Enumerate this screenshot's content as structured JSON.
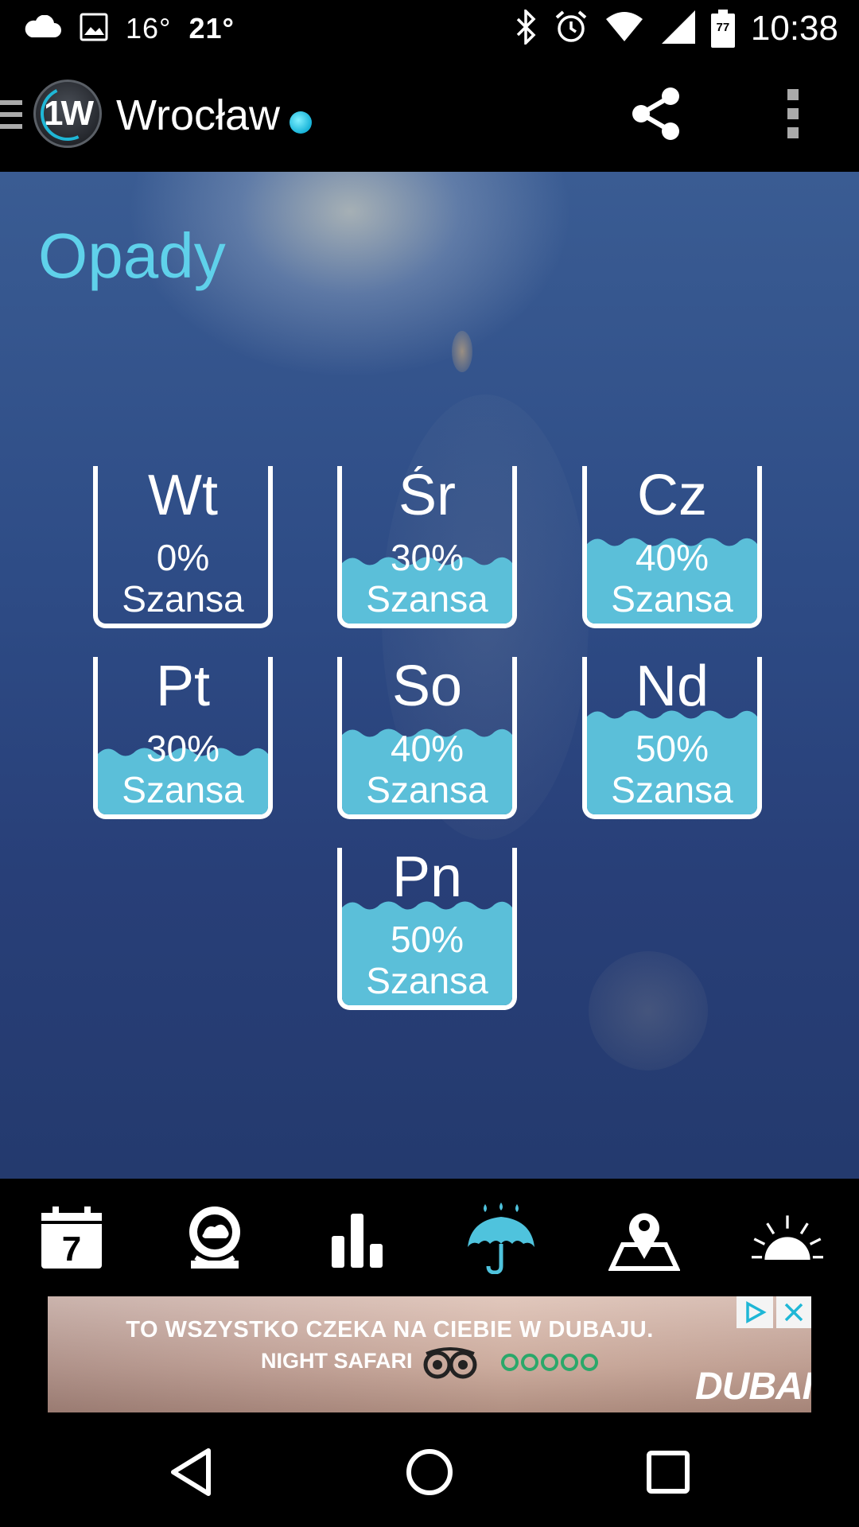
{
  "status_bar": {
    "temp_low": "16°",
    "temp_high": "21°",
    "clock": "10:38",
    "battery_level": "77",
    "icons": [
      "cloud-icon",
      "image-icon",
      "bluetooth-icon",
      "alarm-icon",
      "wifi-icon",
      "signal-icon",
      "battery-icon"
    ]
  },
  "app_bar": {
    "logo_text": "1W",
    "city": "Wrocław",
    "accent_color": "#1fb7d6",
    "actions": [
      "share-icon",
      "more-vert-icon"
    ]
  },
  "section": {
    "title": "Opady",
    "title_color": "#5fd1ea"
  },
  "forecast": [
    {
      "day": "Wt",
      "percent": "0%",
      "label": "Szansa",
      "value": 0
    },
    {
      "day": "Śr",
      "percent": "30%",
      "label": "Szansa",
      "value": 30
    },
    {
      "day": "Cz",
      "percent": "40%",
      "label": "Szansa",
      "value": 40
    },
    {
      "day": "Pt",
      "percent": "30%",
      "label": "Szansa",
      "value": 30
    },
    {
      "day": "So",
      "percent": "40%",
      "label": "Szansa",
      "value": 40
    },
    {
      "day": "Nd",
      "percent": "50%",
      "label": "Szansa",
      "value": 50
    },
    {
      "day": "Pn",
      "percent": "50%",
      "label": "Szansa",
      "value": 50
    }
  ],
  "water_color": "#5bbfd9",
  "bottom_nav": {
    "calendar_day": "7",
    "items": [
      "calendar-icon",
      "globe-icon",
      "bar-chart-icon",
      "umbrella-icon",
      "map-pin-icon",
      "sunrise-icon"
    ],
    "active": "umbrella-icon",
    "active_color": "#4fc3dd"
  },
  "ad": {
    "line1": "TO WSZYSTKO CZEKA NA CIEBIE W DUBAJU.",
    "line2": "NIGHT SAFARI",
    "brand": "DUBAI",
    "icons": [
      "adchoices-icon",
      "close-icon",
      "tripadvisor-owl-icon"
    ]
  },
  "system_nav": [
    "back-icon",
    "home-icon",
    "recents-icon"
  ]
}
